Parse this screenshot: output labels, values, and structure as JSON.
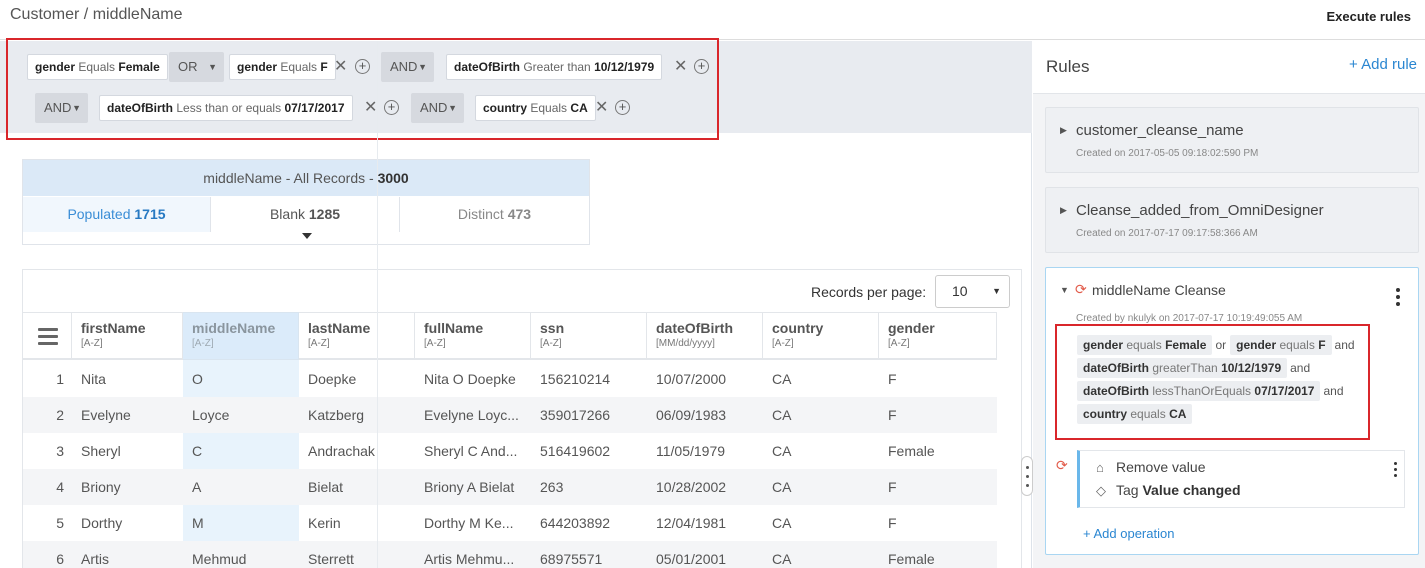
{
  "header": {
    "breadcrumb": "Customer / middleName",
    "execute_label": "Execute rules"
  },
  "filters": {
    "row1": {
      "chip1": {
        "field": "gender",
        "op": "Equals",
        "value": "Female"
      },
      "or_label": "OR",
      "chip2": {
        "field": "gender",
        "op": "Equals",
        "value": "F"
      },
      "and1": "AND",
      "chip3": {
        "field": "dateOfBirth",
        "op": "Greater than",
        "value": "10/12/1979"
      }
    },
    "row2": {
      "and2": "AND",
      "chip4": {
        "field": "dateOfBirth",
        "op": "Less than or equals",
        "value": "07/17/2017"
      },
      "and3": "AND",
      "chip5": {
        "field": "country",
        "op": "Equals",
        "value": "CA"
      }
    }
  },
  "stats": {
    "title": "middleName - All Records - ",
    "total": "3000",
    "populated_label": "Populated",
    "populated_value": "1715",
    "blank_label": "Blank",
    "blank_value": "1285",
    "distinct_label": "Distinct",
    "distinct_value": "473"
  },
  "grid": {
    "records_per_page_label": "Records per page:",
    "records_per_page_value": "10",
    "columns": [
      {
        "name": "firstName",
        "sub": "[A-Z]"
      },
      {
        "name": "middleName",
        "sub": "[A-Z]"
      },
      {
        "name": "lastName",
        "sub": "[A-Z]"
      },
      {
        "name": "fullName",
        "sub": "[A-Z]"
      },
      {
        "name": "ssn",
        "sub": "[A-Z]"
      },
      {
        "name": "dateOfBirth",
        "sub": "[MM/dd/yyyy]"
      },
      {
        "name": "country",
        "sub": "[A-Z]"
      },
      {
        "name": "gender",
        "sub": "[A-Z]"
      }
    ],
    "rows": [
      [
        "1",
        "Nita",
        "O",
        "Doepke",
        "Nita O Doepke",
        "156210214",
        "10/07/2000",
        "CA",
        "F"
      ],
      [
        "2",
        "Evelyne",
        "Loyce",
        "Katzberg",
        "Evelyne Loyc...",
        "359017266",
        "06/09/1983",
        "CA",
        "F"
      ],
      [
        "3",
        "Sheryl",
        "C",
        "Andrachak",
        "Sheryl C And...",
        "516419602",
        "11/05/1979",
        "CA",
        "Female"
      ],
      [
        "4",
        "Briony",
        "A",
        "Bielat",
        "Briony A Bielat",
        "263",
        "10/28/2002",
        "CA",
        "F"
      ],
      [
        "5",
        "Dorthy",
        "M",
        "Kerin",
        "Dorthy M Ke...",
        "644203892",
        "12/04/1981",
        "CA",
        "F"
      ],
      [
        "6",
        "Artis",
        "Mehmud",
        "Sterrett",
        "Artis Mehmu...",
        "68975571",
        "05/01/2001",
        "CA",
        "Female"
      ]
    ]
  },
  "rules": {
    "title": "Rules",
    "add_label": "+ Add rule",
    "items": [
      {
        "name": "customer_cleanse_name",
        "meta": "Created on 2017-05-05 09:18:02:590 PM"
      },
      {
        "name": "Cleanse_added_from_OmniDesigner",
        "meta": "Created on 2017-07-17 09:17:58:366 AM"
      }
    ],
    "active": {
      "name": "middleName Cleanse",
      "meta": "Created by nkulyk on 2017-07-17 10:19:49:055 AM",
      "conditions": {
        "c1": {
          "field": "gender",
          "op": "equals",
          "value": "Female"
        },
        "or": "or",
        "c2": {
          "field": "gender",
          "op": "equals",
          "value": "F"
        },
        "and": "and",
        "c3": {
          "field": "dateOfBirth",
          "op": "greaterThan",
          "value": "10/12/1979"
        },
        "c4": {
          "field": "dateOfBirth",
          "op": "lessThanOrEquals",
          "value": "07/17/2017"
        },
        "c5": {
          "field": "country",
          "op": "equals",
          "value": "CA"
        }
      },
      "operations": {
        "remove": "Remove value",
        "tag_prefix": "Tag",
        "tag_value": "Value changed"
      },
      "add_operation": "+ Add operation"
    }
  },
  "colors": {
    "accent": "#2a86d1",
    "highlight_border": "#d9262b",
    "refresh_icon": "#e25b4a"
  }
}
